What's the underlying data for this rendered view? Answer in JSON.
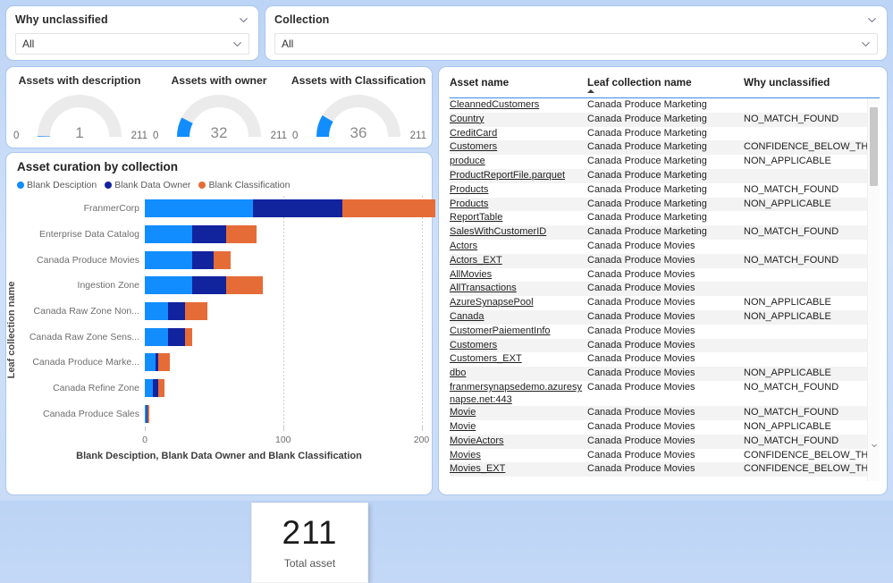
{
  "slicers": [
    {
      "id": "why-unclassified",
      "title": "Why unclassified",
      "value": "All",
      "chevron_icon": "chevron-down-icon"
    },
    {
      "id": "collection",
      "title": "Collection",
      "value": "All",
      "chevron_icon": "chevron-down-icon"
    }
  ],
  "gauges": [
    {
      "title": "Assets with description",
      "value": "1",
      "min": "0",
      "max": "211",
      "value_num": 1,
      "max_num": 211
    },
    {
      "title": "Assets with owner",
      "value": "32",
      "min": "0",
      "max": "211",
      "value_num": 32,
      "max_num": 211
    },
    {
      "title": "Assets with Classification",
      "value": "36",
      "min": "0",
      "max": "211",
      "value_num": 36,
      "max_num": 211
    }
  ],
  "kpi": {
    "value": "211",
    "label": "Total asset"
  },
  "chart_data": {
    "type": "bar",
    "orientation": "horizontal",
    "stacked": true,
    "title": "Asset curation by collection",
    "xlabel": "Blank Desciption, Blank Data Owner and Blank Classification",
    "ylabel": "Leaf collection name",
    "xlim": [
      0,
      210
    ],
    "xticks": [
      0,
      100,
      200
    ],
    "xtick_labels": [
      "0",
      "100",
      "200"
    ],
    "grid": true,
    "legend_position": "top-left",
    "categories": [
      "FranmerCorp",
      "Enterprise Data Catalog",
      "Canada Produce Movies",
      "Ingestion Zone",
      "Canada Raw Zone Non...",
      "Canada Raw Zone Sens...",
      "Canada Produce Marke...",
      "Canada Refine Zone",
      "Canada Produce Sales"
    ],
    "series": [
      {
        "name": "Blank Desciption",
        "color": "#118DFF",
        "values": [
          78,
          34,
          34,
          34,
          17,
          17,
          8,
          6,
          1
        ]
      },
      {
        "name": "Blank Data Owner",
        "color": "#12239E",
        "values": [
          65,
          25,
          16,
          25,
          12,
          12,
          2,
          4,
          1
        ]
      },
      {
        "name": "Blank Classification",
        "color": "#E66C37",
        "values": [
          67,
          22,
          12,
          26,
          16,
          5,
          8,
          4,
          1
        ]
      }
    ]
  },
  "table": {
    "columns": [
      "Asset name",
      "Leaf collection name",
      "Why unclassified"
    ],
    "sorted_column": 1,
    "rows": [
      [
        "CleannedCustomers",
        "Canada Produce Marketing",
        ""
      ],
      [
        "Country",
        "Canada Produce Marketing",
        "NO_MATCH_FOUND"
      ],
      [
        "CreditCard",
        "Canada Produce Marketing",
        ""
      ],
      [
        "Customers",
        "Canada Produce Marketing",
        "CONFIDENCE_BELOW_THRESHOLD"
      ],
      [
        "produce",
        "Canada Produce Marketing",
        "NON_APPLICABLE"
      ],
      [
        "ProductReportFile.parquet",
        "Canada Produce Marketing",
        ""
      ],
      [
        "Products",
        "Canada Produce Marketing",
        "NO_MATCH_FOUND"
      ],
      [
        "Products",
        "Canada Produce Marketing",
        "NON_APPLICABLE"
      ],
      [
        "ReportTable",
        "Canada Produce Marketing",
        ""
      ],
      [
        "SalesWithCustomerID",
        "Canada Produce Marketing",
        "NO_MATCH_FOUND"
      ],
      [
        "Actors",
        "Canada Produce Movies",
        ""
      ],
      [
        "Actors_EXT",
        "Canada Produce Movies",
        "NO_MATCH_FOUND"
      ],
      [
        "AllMovies",
        "Canada Produce Movies",
        ""
      ],
      [
        "AllTransactions",
        "Canada Produce Movies",
        ""
      ],
      [
        "AzureSynapsePool",
        "Canada Produce Movies",
        "NON_APPLICABLE"
      ],
      [
        "Canada",
        "Canada Produce Movies",
        "NON_APPLICABLE"
      ],
      [
        "CustomerPaiementInfo",
        "Canada Produce Movies",
        ""
      ],
      [
        "Customers",
        "Canada Produce Movies",
        ""
      ],
      [
        "Customers_EXT",
        "Canada Produce Movies",
        ""
      ],
      [
        "dbo",
        "Canada Produce Movies",
        "NON_APPLICABLE"
      ],
      [
        "franmersynapsedemo.azuresynapse.net:443",
        "Canada Produce Movies",
        "NO_MATCH_FOUND"
      ],
      [
        "Movie",
        "Canada Produce Movies",
        "NO_MATCH_FOUND"
      ],
      [
        "Movie",
        "Canada Produce Movies",
        "NON_APPLICABLE"
      ],
      [
        "MovieActors",
        "Canada Produce Movies",
        "NO_MATCH_FOUND"
      ],
      [
        "Movies",
        "Canada Produce Movies",
        "CONFIDENCE_BELOW_THRESHOLD"
      ],
      [
        "Movies_EXT",
        "Canada Produce Movies",
        "CONFIDENCE_BELOW_THRESHOLD"
      ]
    ],
    "scroll_up_icon": "chevron-up-icon",
    "scroll_down_icon": "chevron-down-icon"
  },
  "colors": {
    "accent": "#118DFF",
    "series2": "#12239E",
    "series3": "#E66C37",
    "gauge_track": "#EBEBEB",
    "card_border": "#a9c7ee"
  }
}
